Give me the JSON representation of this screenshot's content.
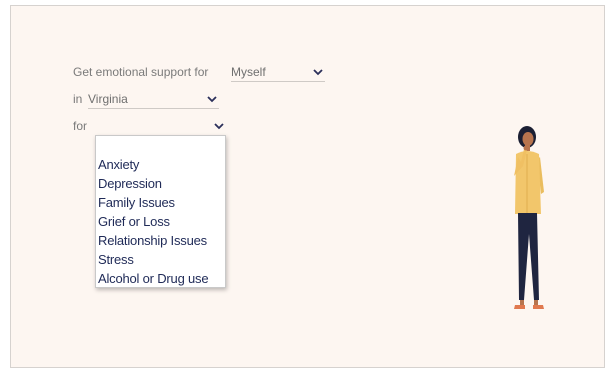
{
  "support": {
    "prefix_label": "Get emotional support for",
    "for_whom_value": "Myself",
    "in_label": "in",
    "state_value": "Virginia",
    "for_label": "for",
    "topic_value": ""
  },
  "topic_options": [
    "Anxiety",
    "Depression",
    "Family Issues",
    "Grief or Loss",
    "Relationship Issues",
    "Stress",
    "Alcohol or Drug use"
  ],
  "icons": {
    "chevron": "chevron-down-icon",
    "illustration": "woman-illustration"
  },
  "colors": {
    "background": "#fdf6f1",
    "option_text": "#1f2a57",
    "chevron": "#2b2f5a",
    "figure_top": "#f2c66b",
    "figure_pants": "#1f2540"
  }
}
